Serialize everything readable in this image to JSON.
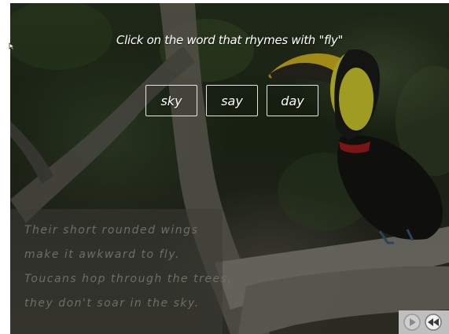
{
  "prompt": "Click on the word that rhymes with \"fly\"",
  "choices": [
    {
      "label": "sky"
    },
    {
      "label": "say"
    },
    {
      "label": "day"
    }
  ],
  "poem": {
    "lines": [
      "Their short rounded wings",
      "make it awkward to fly.",
      "Toucans hop through the trees,",
      "they don't soar in the sky."
    ]
  },
  "controls": {
    "play_icon": "play-icon",
    "rewind_icon": "rewind-icon"
  },
  "colors": {
    "text": "#ffffff",
    "poem_text": "#6e6e66",
    "control_bar": "#bfbfbf"
  }
}
